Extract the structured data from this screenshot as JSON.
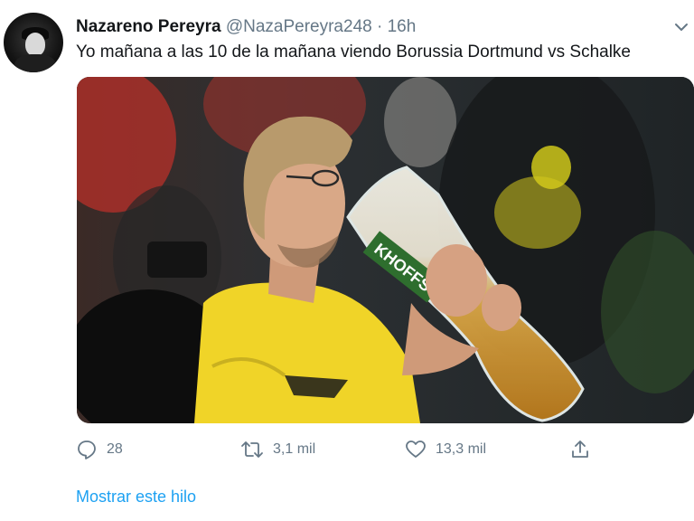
{
  "tweet": {
    "author_name": "Nazareno Pereyra",
    "handle": "@NazaPereyra248",
    "separator": "·",
    "time": "16h",
    "text": "Yo mañana a las 10 de la mañana viendo Borussia Dortmund vs Schalke",
    "media": {
      "glass_label": "KHOFFS",
      "shirt_colors": {
        "yellow": "#f0d428",
        "accent": "#1a1a1a"
      }
    }
  },
  "actions": {
    "reply_count": "28",
    "retweet_count": "3,1 mil",
    "like_count": "13,3 mil",
    "reply_icon": "reply-icon",
    "retweet_icon": "retweet-icon",
    "like_icon": "heart-icon",
    "share_icon": "share-icon"
  },
  "footer": {
    "show_thread": "Mostrar este hilo"
  },
  "colors": {
    "link": "#1da1f2",
    "secondary": "#657786",
    "primary_text": "#14171a"
  }
}
